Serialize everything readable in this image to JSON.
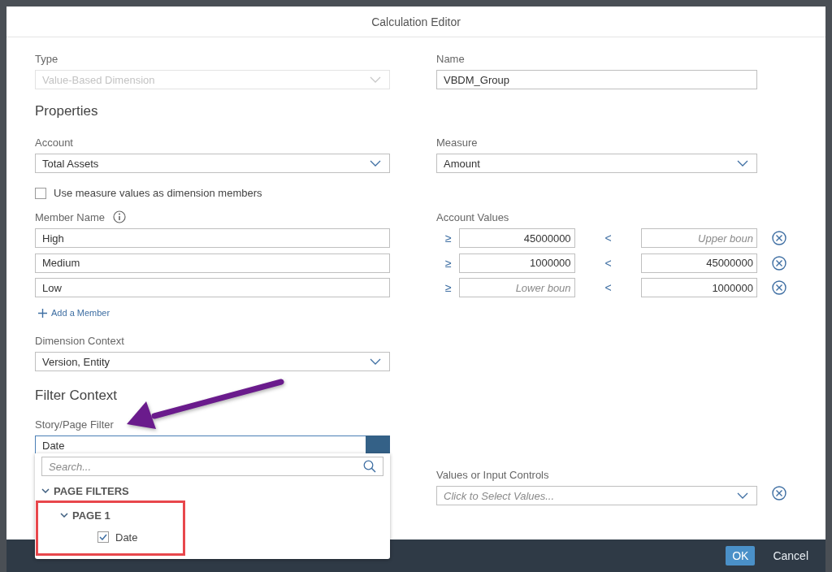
{
  "dialog": {
    "title": "Calculation Editor"
  },
  "type": {
    "label": "Type",
    "value": "Value-Based Dimension",
    "disabled": true
  },
  "name": {
    "label": "Name",
    "value": "VBDM_Group"
  },
  "properties_heading": "Properties",
  "account": {
    "label": "Account",
    "value": "Total Assets"
  },
  "measure": {
    "label": "Measure",
    "value": "Amount"
  },
  "use_measure_values": {
    "label": "Use measure values as dimension members",
    "checked": false
  },
  "member_name_label": "Member Name",
  "account_values_label": "Account Values",
  "members": [
    {
      "name": "High",
      "lower_op": "≥",
      "lower": {
        "value": "45000000"
      },
      "upper_op": "<",
      "upper": {
        "placeholder": "Upper boun"
      }
    },
    {
      "name": "Medium",
      "lower_op": "≥",
      "lower": {
        "value": "1000000"
      },
      "upper_op": "<",
      "upper": {
        "value": "45000000"
      }
    },
    {
      "name": "Low",
      "lower_op": "≥",
      "lower": {
        "placeholder": "Lower boun"
      },
      "upper_op": "<",
      "upper": {
        "value": "1000000"
      }
    }
  ],
  "add_member": "Add a Member",
  "dimension_context": {
    "label": "Dimension Context",
    "value": "Version, Entity"
  },
  "filter_context_heading": "Filter Context",
  "story_page_filter": {
    "label": "Story/Page Filter",
    "value": "Date",
    "expanded": true
  },
  "values_or_input_controls": {
    "label": "Values or Input Controls",
    "placeholder": "Click to Select Values..."
  },
  "filter_popup": {
    "search_placeholder": "Search...",
    "tree": [
      {
        "label": "PAGE FILTERS",
        "expanded": true,
        "children": [
          {
            "label": "PAGE 1",
            "expanded": true,
            "children": [
              {
                "label": "Date",
                "checked": true
              }
            ]
          }
        ]
      }
    ]
  },
  "footer": {
    "buttons": [
      {
        "label": "OK",
        "kind": "primary"
      },
      {
        "label": "Cancel",
        "kind": "secondary"
      }
    ]
  },
  "annotations": [
    {
      "kind": "arrow",
      "color": "#6a1b8c"
    },
    {
      "kind": "rectangle",
      "color": "#e8474c"
    }
  ]
}
